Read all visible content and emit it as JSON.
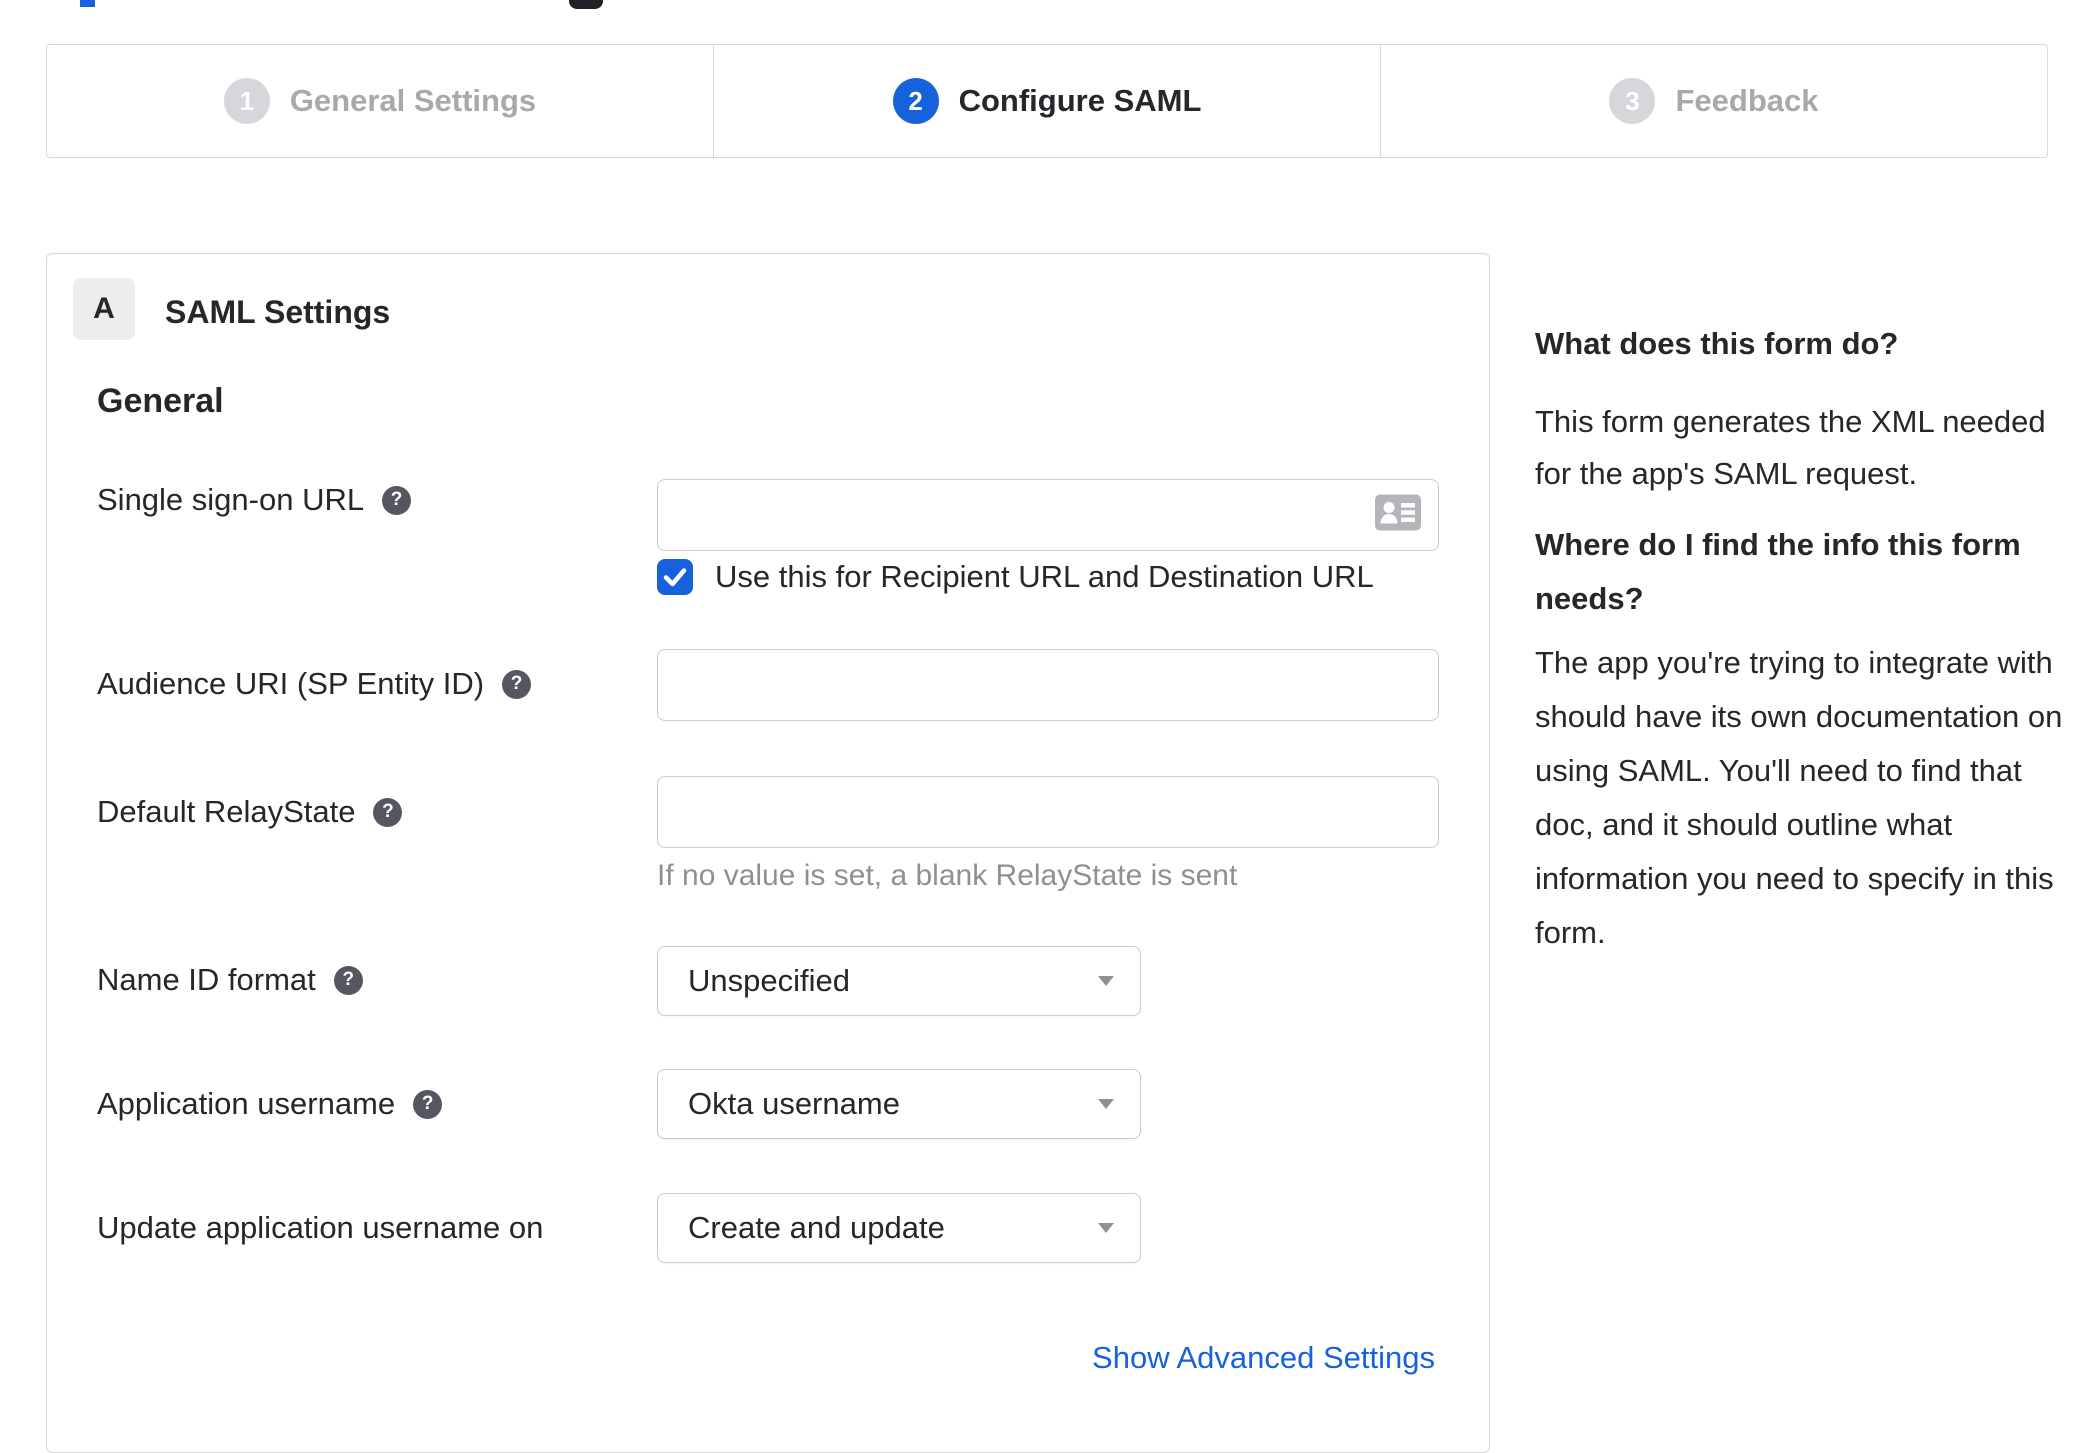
{
  "colors": {
    "accent_blue": "#1662dd",
    "link_blue": "#1662dd",
    "inactive_step_circle": "#d7d7db",
    "inactive_step_text": "#a7a9ac",
    "text": "#26262b",
    "border": "#d8d8dc",
    "hint_text": "#8d9095",
    "help_icon_bg": "#54575f"
  },
  "icons": {
    "sso_input_icon": "contact-card-icon",
    "field_help_icon": "question-mark-icon",
    "checkbox_icon": "checkmark-icon",
    "select_icon": "chevron-down-icon"
  },
  "stepper": {
    "steps": [
      {
        "number": "1",
        "label": "General Settings",
        "active": false
      },
      {
        "number": "2",
        "label": "Configure SAML",
        "active": true
      },
      {
        "number": "3",
        "label": "Feedback",
        "active": false
      }
    ]
  },
  "panel": {
    "badge": "A",
    "title": "SAML Settings",
    "section": "General",
    "fields": {
      "sso": {
        "label": "Single sign-on URL",
        "value": "",
        "checkbox_label": "Use this for Recipient URL and Destination URL",
        "checkbox_checked": true
      },
      "audience": {
        "label": "Audience URI (SP Entity ID)",
        "value": ""
      },
      "relay": {
        "label": "Default RelayState",
        "value": "",
        "hint": "If no value is set, a blank RelayState is sent"
      },
      "name_id": {
        "label": "Name ID format",
        "value": "Unspecified"
      },
      "app_username": {
        "label": "Application username",
        "value": "Okta username"
      },
      "update_username": {
        "label": "Update application username on",
        "value": "Create and update"
      }
    },
    "advanced_link": "Show Advanced Settings"
  },
  "sidebar": {
    "what_heading": "What does this form do?",
    "what_body": "This form generates the XML needed\nfor the app's SAML request.",
    "where_heading": "Where do I find the info this form\nneeds?",
    "where_body": "The app you're trying to integrate with\nshould have its own documentation on\nusing SAML. You'll need to find that\ndoc, and it should outline what\ninformation you need to specify in this\nform."
  }
}
